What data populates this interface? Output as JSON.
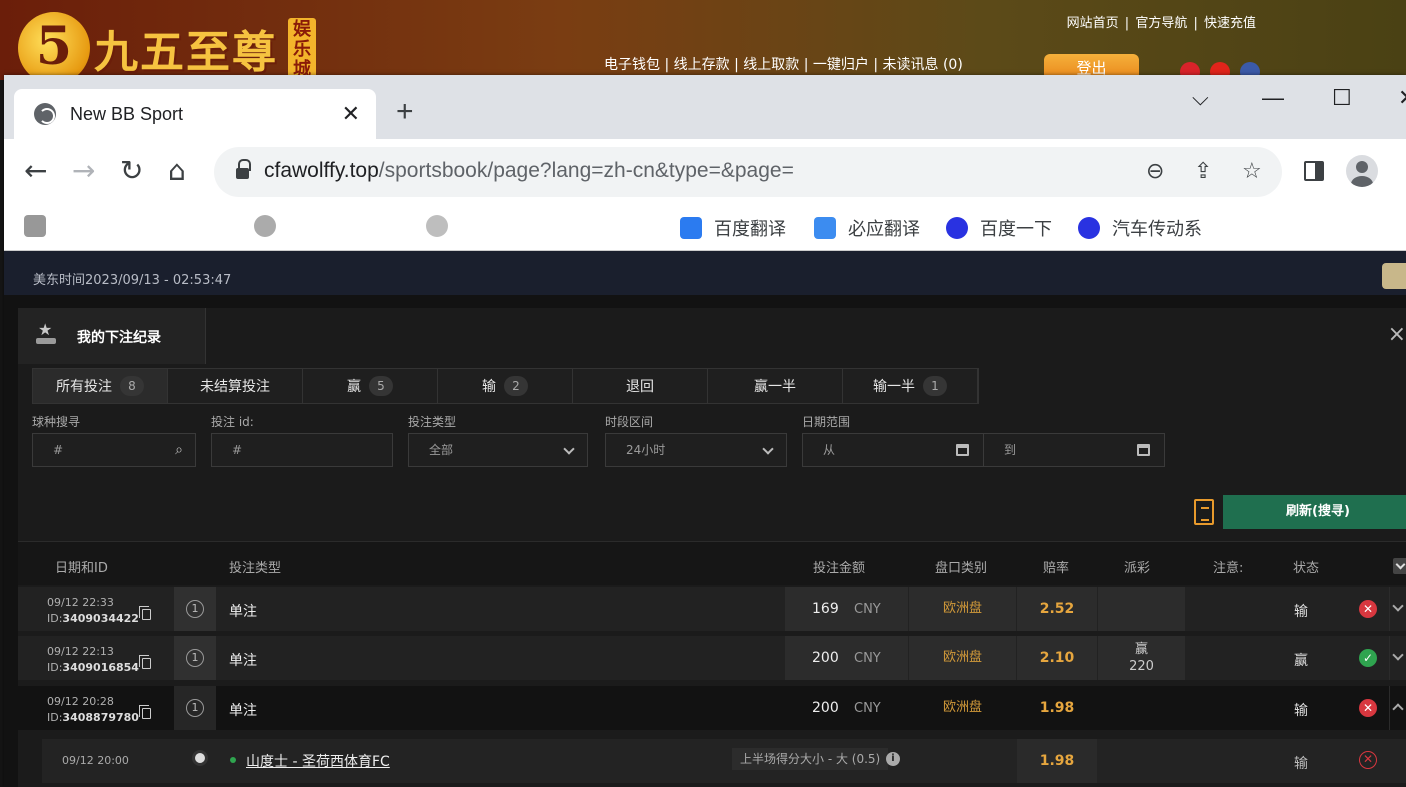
{
  "site": {
    "logo_mark": "5",
    "logo_text": "九五至尊",
    "logo_badge": "娱乐城",
    "top_links": [
      "网站首页",
      "官方导航",
      "快速充值"
    ],
    "nav_links": [
      "电子钱包",
      "线上存款",
      "线上取款",
      "一键归户",
      "未读讯息 (0)"
    ],
    "logout": "登出"
  },
  "browser": {
    "tab_title": "New BB Sport",
    "tab_close": "✕",
    "new_tab": "+",
    "url_host": "cfawolffy.top",
    "url_path": "/sportsbook/page?lang=zh-cn&type=&page=",
    "bookmarks": [
      "百度翻译",
      "必应翻译",
      "百度一下",
      "汽车传动系"
    ]
  },
  "page": {
    "us_time": "美东时间2023/09/13 - 02:53:47",
    "modal_title": "我的下注纪录",
    "close": "×",
    "tabs": [
      {
        "label": "所有投注",
        "count": "8"
      },
      {
        "label": "未结算投注",
        "count": ""
      },
      {
        "label": "赢",
        "count": "5"
      },
      {
        "label": "输",
        "count": "2"
      },
      {
        "label": "退回",
        "count": ""
      },
      {
        "label": "赢一半",
        "count": ""
      },
      {
        "label": "输一半",
        "count": "1"
      }
    ],
    "filters": {
      "sport_label": "球种搜寻",
      "sport_placeholder": "#",
      "betid_label": "投注 id:",
      "betid_placeholder": "#",
      "bettype_label": "投注类型",
      "bettype_value": "全部",
      "period_label": "时段区间",
      "period_value": "24小时",
      "daterange_label": "日期范围",
      "from": "从",
      "to": "到"
    },
    "refresh": "刷新(搜寻)",
    "columns": [
      "日期和ID",
      "投注类型",
      "投注金额",
      "盘口类别",
      "赔率",
      "派彩",
      "注意:",
      "状态"
    ],
    "rows": [
      {
        "date": "09/12 22:33",
        "id_prefix": "ID:",
        "id": "3409034422",
        "num": "1",
        "type": "单注",
        "amount": "169",
        "currency": "CNY",
        "market": "欧洲盘",
        "odds": "2.52",
        "payout_label": "",
        "payout": "",
        "status": "输",
        "result": "lose"
      },
      {
        "date": "09/12 22:13",
        "id_prefix": "ID:",
        "id": "3409016854",
        "num": "1",
        "type": "单注",
        "amount": "200",
        "currency": "CNY",
        "market": "欧洲盘",
        "odds": "2.10",
        "payout_label": "赢",
        "payout": "220",
        "status": "赢",
        "result": "win"
      },
      {
        "date": "09/12 20:28",
        "id_prefix": "ID:",
        "id": "3408879780",
        "num": "1",
        "type": "单注",
        "amount": "200",
        "currency": "CNY",
        "market": "欧洲盘",
        "odds": "1.98",
        "payout_label": "",
        "payout": "",
        "status": "输",
        "result": "lose"
      }
    ],
    "detail": {
      "date": "09/12 20:00",
      "match": "山度士 - 圣荷西体育FC",
      "selection": "上半场得分大小 - 大 (0.5)",
      "odds": "1.98",
      "status": "输"
    }
  }
}
